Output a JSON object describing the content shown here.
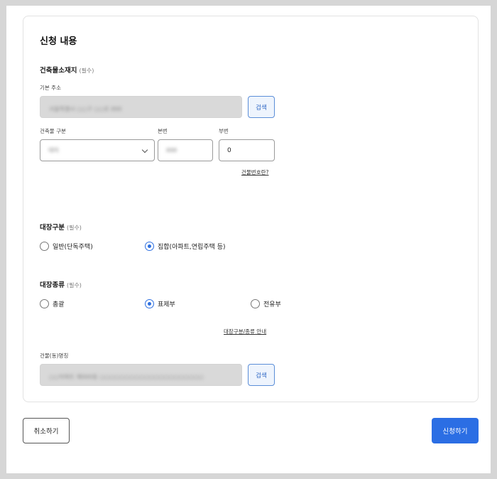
{
  "card": {
    "title": "신청 내용"
  },
  "location": {
    "title": "건축물소재지",
    "required": "(필수)",
    "address_label": "기본 주소",
    "address_value": "서울특별시 ○○구 ○○로 000",
    "search_label": "검색",
    "type_label": "건축물 구분",
    "type_value": "대지",
    "main_no_label": "본번",
    "main_no_value": "000",
    "sub_no_label": "부번",
    "sub_no_value": "0",
    "help_link": "건물번호란?"
  },
  "ledger_type": {
    "title": "대장구분",
    "required": "(필수)",
    "options": [
      {
        "label": "일반(단독주택)",
        "selected": false
      },
      {
        "label": "집합(아파트,연립주택 등)",
        "selected": true
      }
    ]
  },
  "ledger_kind": {
    "title": "대장종류",
    "required": "(필수)",
    "options": [
      {
        "label": "총괄",
        "selected": false
      },
      {
        "label": "표제부",
        "selected": true
      },
      {
        "label": "전유부",
        "selected": false
      }
    ],
    "guide_link": "대장구분/종류 안내"
  },
  "building": {
    "label": "건물(동)명칭",
    "value": "○○아파트 제000동 ○○○○○○○○○○○○○○○○○○○○○",
    "search_label": "검색"
  },
  "footer": {
    "cancel_label": "취소하기",
    "submit_label": "신청하기"
  },
  "colors": {
    "accent": "#2b6ee4",
    "background": "#d6d6d6"
  }
}
